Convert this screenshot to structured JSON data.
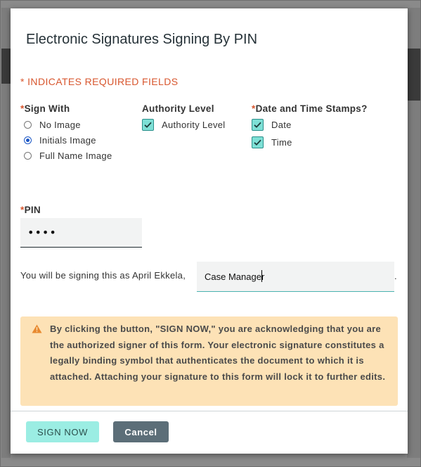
{
  "dialog": {
    "title": "Electronic Signatures Signing By PIN",
    "required_note": "* INDICATES REQUIRED FIELDS"
  },
  "sign_with": {
    "label": "Sign With",
    "required_mark": "*",
    "options": [
      {
        "label": "No Image",
        "selected": false
      },
      {
        "label": "Initials Image",
        "selected": true
      },
      {
        "label": "Full Name Image",
        "selected": false
      }
    ]
  },
  "authority": {
    "label": "Authority Level",
    "option_label": "Authority Level",
    "checked": true
  },
  "timestamps": {
    "label": "Date and Time Stamps?",
    "required_mark": "*",
    "options": [
      {
        "label": "Date",
        "checked": true
      },
      {
        "label": "Time",
        "checked": true
      }
    ]
  },
  "pin": {
    "label": "PIN",
    "required_mark": "*",
    "value": "••••"
  },
  "signing": {
    "text": "You will be signing this as April Ekkela,",
    "role_value": "Case Manager",
    "suffix": "."
  },
  "warning": {
    "icon": "warning-icon",
    "text": "By clicking the button, \"SIGN NOW,\" you are acknowledging that you are the authorized signer of this form. Your electronic signature constitutes a legally binding symbol that authenticates the document to which it is attached. Attaching your signature to this form will lock it to further edits."
  },
  "buttons": {
    "sign_now": "SIGN NOW",
    "cancel": "Cancel"
  },
  "colors": {
    "accent_teal": "#9bede3",
    "checkbox_fill": "#7ee0d6",
    "required_red": "#d8572f",
    "warning_bg": "#fde2b6",
    "cancel_bg": "#5c6e78"
  }
}
